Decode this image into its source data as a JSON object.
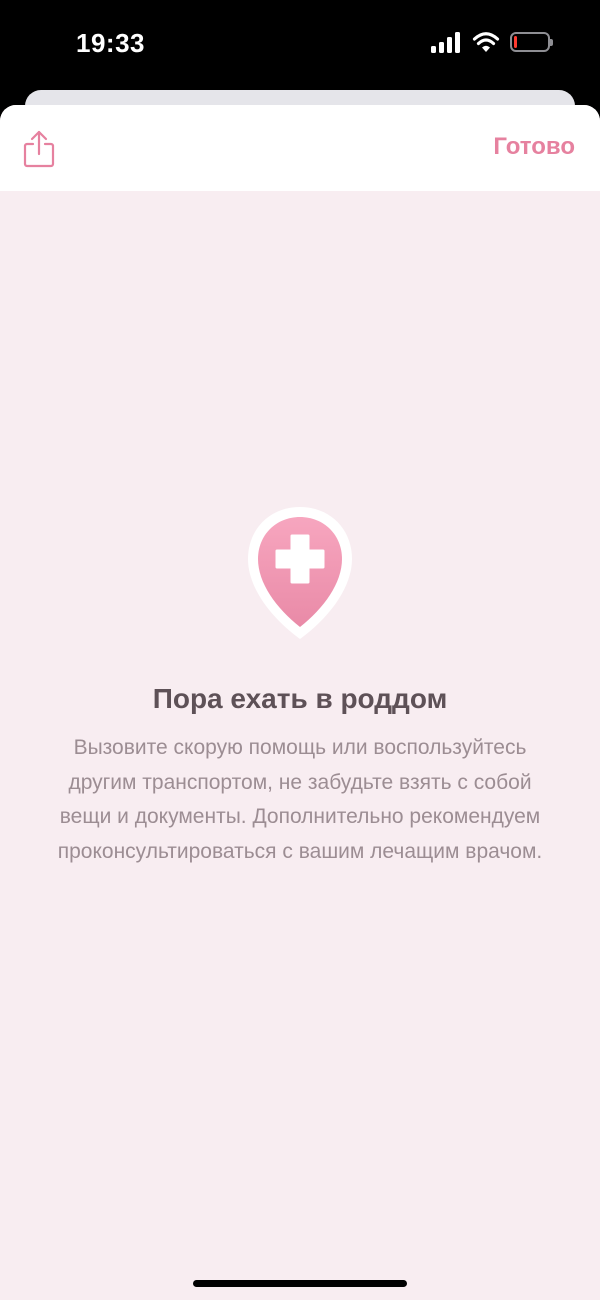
{
  "status_bar": {
    "time": "19:33",
    "icons": [
      "cellular-signal-icon",
      "wifi-icon",
      "battery-icon"
    ]
  },
  "nav": {
    "share_icon": "share-icon",
    "done_label": "Готово"
  },
  "content": {
    "icon": "map-pin-medical-cross-icon",
    "title": "Пора ехать в роддом",
    "description": "Вызовите скорую помощь или воспользуйтесь другим транспортом, не забудьте взять с собой вещи и документы. Дополнительно рекомендуем проконсультироваться с вашим лечащим врачом."
  },
  "colors": {
    "accent": "#e6819f",
    "background": "#f8edf1",
    "title": "#5e5157",
    "body": "#9c8d93"
  }
}
